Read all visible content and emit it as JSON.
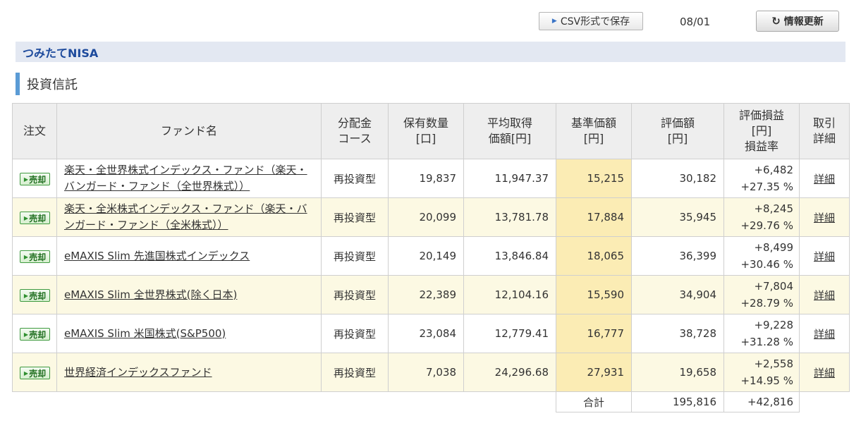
{
  "toolbar": {
    "csv_label": "CSV形式で保存",
    "date": "08/01",
    "refresh_label": "情報更新"
  },
  "section": {
    "title": "つみたてNISA",
    "subtitle": "投資信託"
  },
  "table": {
    "headers": {
      "order": "注文",
      "fund_name": "ファンド名",
      "course_1": "分配金",
      "course_2": "コース",
      "quantity_1": "保有数量",
      "quantity_2": "[口]",
      "avg_1": "平均取得",
      "avg_2": "価額[円]",
      "nav_1": "基準価額",
      "nav_2": "[円]",
      "value_1": "評価額",
      "value_2": "[円]",
      "pl_1": "評価損益",
      "pl_2": "[円]",
      "pl_3": "損益率",
      "detail_1": "取引",
      "detail_2": "詳細"
    },
    "sell_label": "売却",
    "detail_label": "詳細",
    "rows": [
      {
        "name": "楽天・全世界株式インデックス・ファンド（楽天・バンガード・ファンド（全世界株式））",
        "course": "再投資型",
        "quantity": "19,837",
        "avg_price": "11,947.37",
        "nav": "15,215",
        "value": "30,182",
        "pl": "+6,482",
        "pl_rate": "+27.35 %"
      },
      {
        "name": "楽天・全米株式インデックス・ファンド（楽天・バンガード・ファンド（全米株式））",
        "course": "再投資型",
        "quantity": "20,099",
        "avg_price": "13,781.78",
        "nav": "17,884",
        "value": "35,945",
        "pl": "+8,245",
        "pl_rate": "+29.76 %"
      },
      {
        "name": "eMAXIS Slim 先進国株式インデックス",
        "course": "再投資型",
        "quantity": "20,149",
        "avg_price": "13,846.84",
        "nav": "18,065",
        "value": "36,399",
        "pl": "+8,499",
        "pl_rate": "+30.46 %"
      },
      {
        "name": "eMAXIS Slim 全世界株式(除く日本)",
        "course": "再投資型",
        "quantity": "22,389",
        "avg_price": "12,104.16",
        "nav": "15,590",
        "value": "34,904",
        "pl": "+7,804",
        "pl_rate": "+28.79 %"
      },
      {
        "name": "eMAXIS Slim 米国株式(S&P500)",
        "course": "再投資型",
        "quantity": "23,084",
        "avg_price": "12,779.41",
        "nav": "16,777",
        "value": "38,728",
        "pl": "+9,228",
        "pl_rate": "+31.28 %"
      },
      {
        "name": "世界経済インデックスファンド",
        "course": "再投資型",
        "quantity": "7,038",
        "avg_price": "24,296.68",
        "nav": "27,931",
        "value": "19,658",
        "pl": "+2,558",
        "pl_rate": "+14.95 %"
      }
    ],
    "total": {
      "label": "合計",
      "value": "195,816",
      "pl": "+42,816"
    }
  }
}
